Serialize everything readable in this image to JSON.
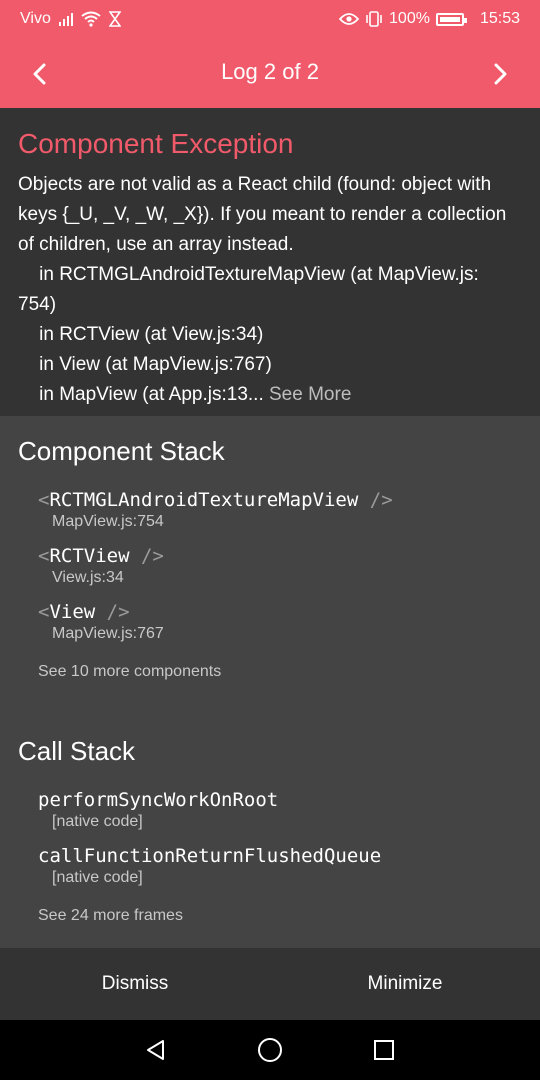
{
  "status_bar": {
    "carrier": "Vivo",
    "battery_percent": "100%",
    "time": "15:53"
  },
  "header": {
    "title": "Log 2 of 2"
  },
  "exception": {
    "title": "Component Exception",
    "message": "Objects are not valid as a React child (found: object with keys {_U, _V, _W, _X}). If you meant to render a collection of children, use an array instead.\n    in RCTMGLAndroidTextureMapView (at MapView.js:\n754)\n    in RCTView (at View.js:34)\n    in View (at MapView.js:767)\n    in MapView (at App.js:13...",
    "see_more": " See More"
  },
  "component_stack": {
    "title": "Component Stack",
    "frames": [
      {
        "name": "RCTMGLAndroidTextureMapView",
        "location": "MapView.js:754"
      },
      {
        "name": "RCTView",
        "location": "View.js:34"
      },
      {
        "name": "View",
        "location": "MapView.js:767"
      }
    ],
    "open_tag": "<",
    "close_tag": " />",
    "more": "See 10 more components"
  },
  "call_stack": {
    "title": "Call Stack",
    "frames": [
      {
        "name": "performSyncWorkOnRoot",
        "location": "[native code]"
      },
      {
        "name": "callFunctionReturnFlushedQueue",
        "location": "[native code]"
      }
    ],
    "more": "See 24 more frames"
  },
  "footer": {
    "dismiss": "Dismiss",
    "minimize": "Minimize"
  }
}
